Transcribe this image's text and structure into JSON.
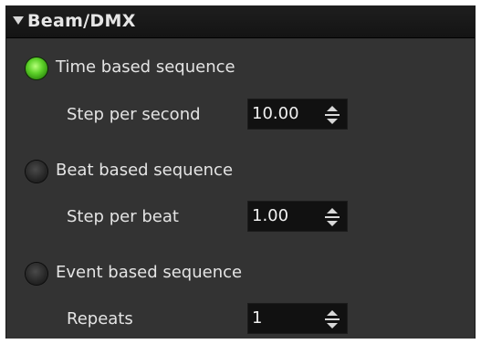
{
  "header": {
    "title": "Beam/DMX",
    "icon": "triangle-down-icon"
  },
  "options": [
    {
      "label": "Time based sequence",
      "selected": true,
      "field_label": "Step per second",
      "field_value": "10.00"
    },
    {
      "label": "Beat based sequence",
      "selected": false,
      "field_label": "Step per beat",
      "field_value": "1.00"
    },
    {
      "label": "Event based sequence",
      "selected": false,
      "field_label": "Repeats",
      "field_value": "1"
    }
  ],
  "colors": {
    "panel_bg": "#333333",
    "header_bg": "#1a1a1a",
    "radio_on": "#5ed12a",
    "input_bg": "#111111",
    "text": "#e4e4e4"
  }
}
